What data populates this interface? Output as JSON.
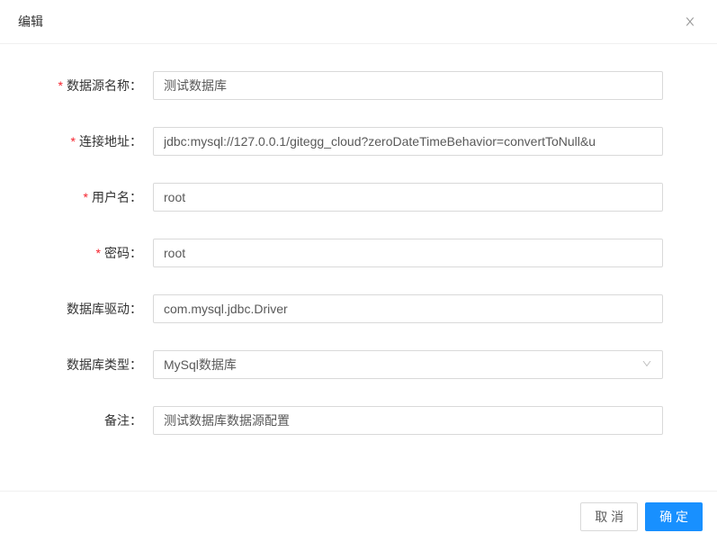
{
  "header": {
    "title": "编辑"
  },
  "form": {
    "datasourceName": {
      "label": "数据源名称",
      "value": "测试数据库",
      "required": true
    },
    "connectionUrl": {
      "label": "连接地址",
      "value": "jdbc:mysql://127.0.0.1/gitegg_cloud?zeroDateTimeBehavior=convertToNull&u",
      "required": true
    },
    "username": {
      "label": "用户名",
      "value": "root",
      "required": true
    },
    "password": {
      "label": "密码",
      "value": "root",
      "required": true
    },
    "driver": {
      "label": "数据库驱动",
      "value": "com.mysql.jdbc.Driver",
      "required": false
    },
    "dbType": {
      "label": "数据库类型",
      "value": "MySql数据库",
      "required": false
    },
    "remark": {
      "label": "备注",
      "value": "测试数据库数据源配置",
      "required": false
    }
  },
  "footer": {
    "cancel": "取 消",
    "confirm": "确 定"
  }
}
